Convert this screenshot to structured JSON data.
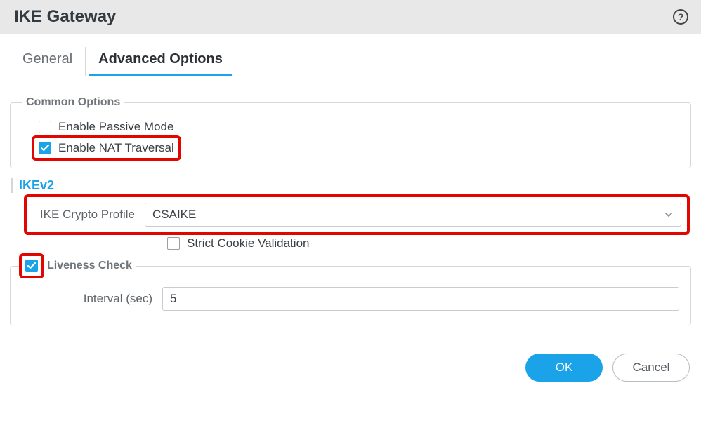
{
  "header": {
    "title": "IKE Gateway"
  },
  "tabs": {
    "general": "General",
    "advanced": "Advanced Options",
    "active": "advanced"
  },
  "common_options": {
    "legend": "Common Options",
    "passive_mode": {
      "label": "Enable Passive Mode",
      "checked": false
    },
    "nat_traversal": {
      "label": "Enable NAT Traversal",
      "checked": true
    }
  },
  "ikev2": {
    "title": "IKEv2",
    "crypto_profile": {
      "label": "IKE Crypto Profile",
      "value": "CSAIKE"
    },
    "strict_cookie": {
      "label": "Strict Cookie Validation",
      "checked": false
    }
  },
  "liveness": {
    "legend": "Liveness Check",
    "checked": true,
    "interval": {
      "label": "Interval (sec)",
      "value": "5"
    }
  },
  "footer": {
    "ok": "OK",
    "cancel": "Cancel"
  },
  "colors": {
    "accent": "#1aa3e8",
    "highlight": "#e10600"
  }
}
